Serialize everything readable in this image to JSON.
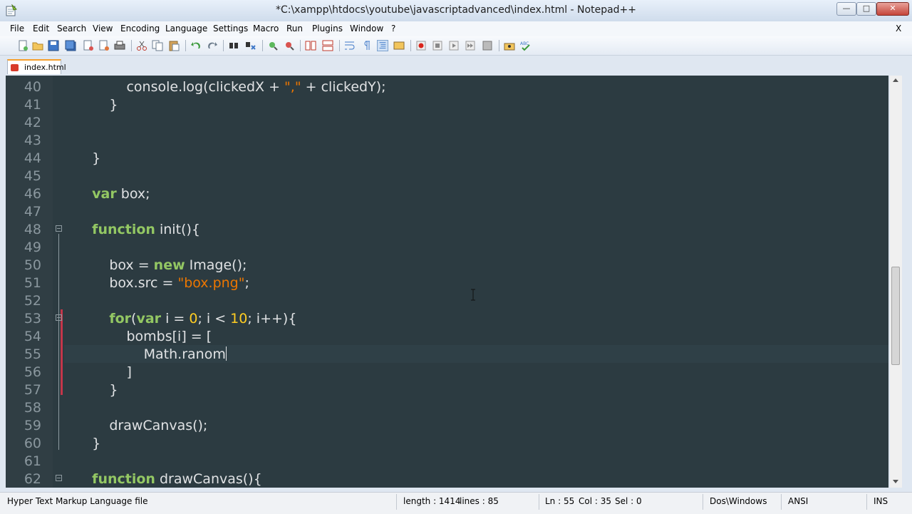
{
  "window": {
    "title": "*C:\\xampp\\htdocs\\youtube\\javascriptadvanced\\index.html - Notepad++"
  },
  "menu": {
    "items": [
      "File",
      "Edit",
      "Search",
      "View",
      "Encoding",
      "Language",
      "Settings",
      "Macro",
      "Run",
      "Plugins",
      "Window",
      "?"
    ],
    "close": "X"
  },
  "toolbar": {
    "icons": [
      "new-file-icon",
      "open-file-icon",
      "save-icon",
      "save-all-icon",
      "close-icon",
      "close-all-icon",
      "print-icon",
      "cut-icon",
      "copy-icon",
      "paste-icon",
      "undo-icon",
      "redo-icon",
      "find-icon",
      "replace-icon",
      "zoom-in-icon",
      "zoom-out-icon",
      "sync-v-icon",
      "sync-h-icon",
      "word-wrap-icon",
      "show-all-chars-icon",
      "indent-guide-icon",
      "user-lang-icon",
      "record-macro-icon",
      "stop-macro-icon",
      "play-macro-icon",
      "run-macro-multiple-icon",
      "save-macro-icon",
      "trim-icon",
      "spellcheck-icon"
    ]
  },
  "tabs": [
    {
      "label": "index.html",
      "active": true
    }
  ],
  "editor": {
    "lines": [
      {
        "n": "40",
        "html": "            console.log(clickedX + <span class=\"str\">\",\"</span> + clickedY);"
      },
      {
        "n": "41",
        "html": "        }"
      },
      {
        "n": "42",
        "html": ""
      },
      {
        "n": "43",
        "html": ""
      },
      {
        "n": "44",
        "html": "    }"
      },
      {
        "n": "45",
        "html": ""
      },
      {
        "n": "46",
        "html": "    <span class=\"kw\">var</span> box;"
      },
      {
        "n": "47",
        "html": ""
      },
      {
        "n": "48",
        "html": "    <span class=\"kw\">function</span> init(){"
      },
      {
        "n": "49",
        "html": ""
      },
      {
        "n": "50",
        "html": "        box = <span class=\"kw\">new</span> Image();"
      },
      {
        "n": "51",
        "html": "        box.src = <span class=\"str\">\"box.png\"</span>;"
      },
      {
        "n": "52",
        "html": ""
      },
      {
        "n": "53",
        "html": "        <span class=\"kw\">for</span>(<span class=\"kw\">var</span> i = <span class=\"num\">0</span>; i &lt; <span class=\"num\">10</span>; i++){"
      },
      {
        "n": "54",
        "html": "            bombs[i] = ["
      },
      {
        "n": "55",
        "html": "                Math.ranom<span class=\"caret\"></span>"
      },
      {
        "n": "56",
        "html": "            ]"
      },
      {
        "n": "57",
        "html": "        }"
      },
      {
        "n": "58",
        "html": ""
      },
      {
        "n": "59",
        "html": "        drawCanvas();"
      },
      {
        "n": "60",
        "html": "    }"
      },
      {
        "n": "61",
        "html": ""
      },
      {
        "n": "62",
        "html": "    <span class=\"kw\">function</span> drawCanvas(){"
      }
    ],
    "colors": {
      "background": "#2c3b41",
      "keyword": "#93c763",
      "string": "#ec7600",
      "number": "#ffcd22",
      "text": "#e0e2e4",
      "line_number": "#8a979e"
    }
  },
  "status": {
    "file_type": "Hyper Text Markup Language file",
    "length": "length : 1414",
    "lines": "lines : 85",
    "ln": "Ln : 55",
    "col": "Col : 35",
    "sel": "Sel : 0",
    "eol": "Dos\\Windows",
    "encoding": "ANSI",
    "mode": "INS"
  }
}
